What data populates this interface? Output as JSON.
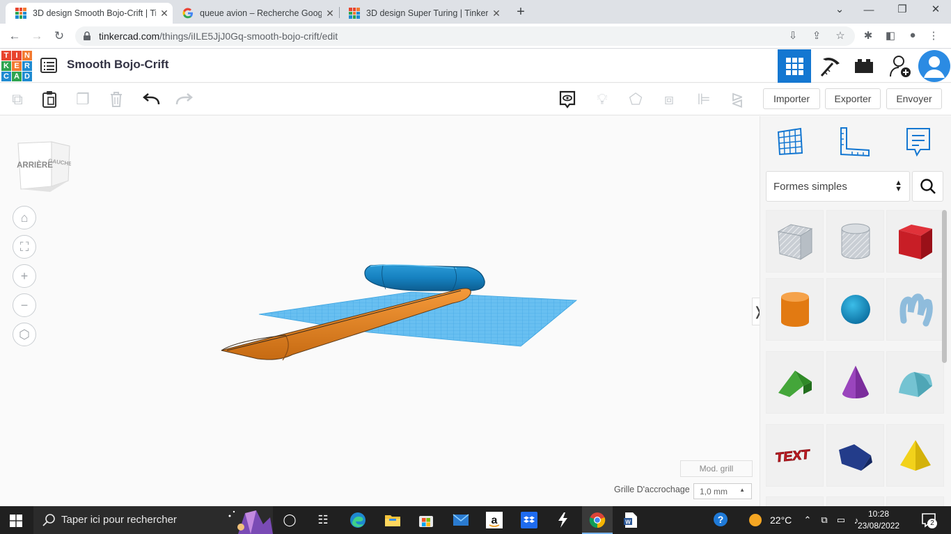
{
  "browser": {
    "tabs": [
      {
        "title": "3D design Smooth Bojo-Crift | Tinkercad",
        "active": true
      },
      {
        "title": "queue avion – Recherche Google",
        "active": false
      },
      {
        "title": "3D design Super Turing | Tinkercad",
        "active": false
      }
    ],
    "url_domain": "tinkercad.com",
    "url_path": "/things/iILE5JjJ0Gq-smooth-bojo-crift/edit"
  },
  "app": {
    "logo_letters": [
      "T",
      "I",
      "N",
      "K",
      "E",
      "R",
      "C",
      "A",
      "D"
    ],
    "logo_colors": [
      "#e8442e",
      "#e8442e",
      "#f37a30",
      "#2ea44f",
      "#f37a30",
      "#1f8bd1",
      "#1f8bd1",
      "#2ea44f",
      "#1f8bd1"
    ],
    "design_title": "Smooth Bojo-Crift",
    "accent": "#1477d1"
  },
  "toolbar": {
    "import_label": "Importer",
    "export_label": "Exporter",
    "send_label": "Envoyer"
  },
  "viewcube": {
    "back_label": "ARRIÈRE",
    "left_label": "GAUCHE"
  },
  "viewport": {
    "mod_grid_label": "Mod. grill",
    "snap_grid_label": "Grille D'accrochage",
    "snap_grid_value": "1,0 mm"
  },
  "panel": {
    "shape_category": "Formes simples",
    "shapes": [
      "box-hole",
      "cylinder-hole",
      "box",
      "cylinder",
      "sphere",
      "scribble",
      "roof",
      "cone",
      "round-roof",
      "text",
      "wedge",
      "pyramid"
    ]
  },
  "taskbar": {
    "search_placeholder": "Taper ici pour rechercher",
    "weather": "22°C",
    "time": "10:28",
    "date": "23/08/2022",
    "notifications": "2"
  }
}
